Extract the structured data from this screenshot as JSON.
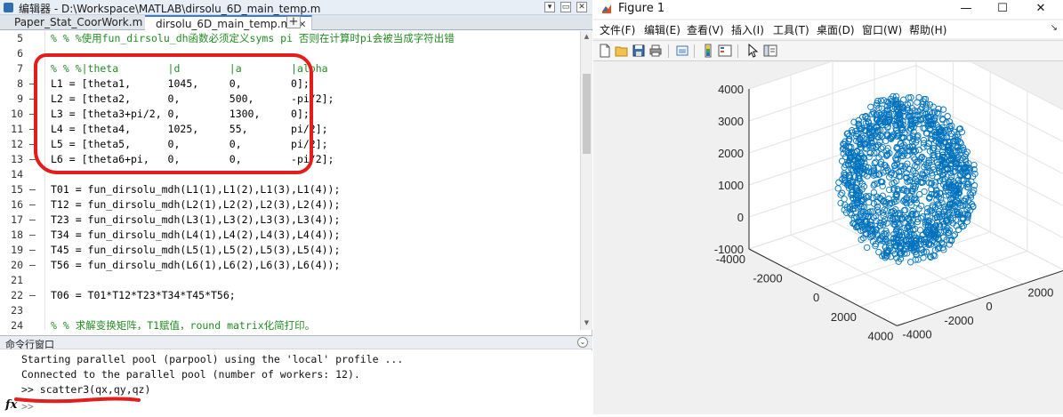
{
  "editor": {
    "title": "编辑器 - D:\\Workspace\\MATLAB\\dirsolu_6D_main_temp.m",
    "controls": {
      "options": "▾",
      "minimize": "▭",
      "close": "✕"
    },
    "tabs": [
      {
        "label": "Paper_Stat_CoorWork.m",
        "close": "✕",
        "active": false
      },
      {
        "label": "dirsolu_6D_main_temp.m",
        "close": "✕",
        "active": true
      }
    ],
    "add_tab": "+",
    "lines": [
      {
        "num": "5",
        "mark": "",
        "text": "% % %使用fun_dirsolu_dh函数必须定义syms pi 否则在计算时pi会被当成字符出错",
        "comment": true
      },
      {
        "num": "6",
        "mark": "",
        "text": "",
        "comment": false
      },
      {
        "num": "7",
        "mark": "",
        "text": "% % %|theta        |d        |a        |alpha",
        "comment": true
      },
      {
        "num": "8",
        "mark": "—",
        "text": "L1 = [theta1,      1045,     0,        0];",
        "comment": false
      },
      {
        "num": "9",
        "mark": "—",
        "text": "L2 = [theta2,      0,        500,      -pi/2];",
        "comment": false
      },
      {
        "num": "10",
        "mark": "—",
        "text": "L3 = [theta3+pi/2, 0,        1300,     0];",
        "comment": false
      },
      {
        "num": "11",
        "mark": "—",
        "text": "L4 = [theta4,      1025,     55,       pi/2];",
        "comment": false
      },
      {
        "num": "12",
        "mark": "—",
        "text": "L5 = [theta5,      0,        0,        pi/2];",
        "comment": false
      },
      {
        "num": "13",
        "mark": "—",
        "text": "L6 = [theta6+pi,   0,        0,        -pi/2];",
        "comment": false
      },
      {
        "num": "14",
        "mark": "",
        "text": "",
        "comment": false
      },
      {
        "num": "15",
        "mark": "—",
        "text": "T01 = fun_dirsolu_mdh(L1(1),L1(2),L1(3),L1(4));",
        "comment": false
      },
      {
        "num": "16",
        "mark": "—",
        "text": "T12 = fun_dirsolu_mdh(L2(1),L2(2),L2(3),L2(4));",
        "comment": false
      },
      {
        "num": "17",
        "mark": "—",
        "text": "T23 = fun_dirsolu_mdh(L3(1),L3(2),L3(3),L3(4));",
        "comment": false
      },
      {
        "num": "18",
        "mark": "—",
        "text": "T34 = fun_dirsolu_mdh(L4(1),L4(2),L4(3),L4(4));",
        "comment": false
      },
      {
        "num": "19",
        "mark": "—",
        "text": "T45 = fun_dirsolu_mdh(L5(1),L5(2),L5(3),L5(4));",
        "comment": false
      },
      {
        "num": "20",
        "mark": "—",
        "text": "T56 = fun_dirsolu_mdh(L6(1),L6(2),L6(3),L6(4));",
        "comment": false
      },
      {
        "num": "21",
        "mark": "",
        "text": "",
        "comment": false
      },
      {
        "num": "22",
        "mark": "—",
        "text": "T06 = T01*T12*T23*T34*T45*T56;",
        "comment": false
      },
      {
        "num": "23",
        "mark": "",
        "text": "",
        "comment": false
      },
      {
        "num": "24",
        "mark": "",
        "text": "% % 求解变换矩阵，T1赋值，round_matrix化简打印。",
        "comment": true
      }
    ]
  },
  "command_window": {
    "header": "命令行窗口",
    "options_icon": "⌄",
    "lines": [
      "Starting parallel pool (parpool) using the 'local' profile ...",
      "Connected to the parallel pool (number of workers: 12).",
      ">> scatter3(qx,qy,qz)"
    ],
    "fx": "fx",
    "prompt": ">>"
  },
  "figure": {
    "title": "Figure 1",
    "controls": {
      "minimize": "—",
      "maximize": "☐",
      "close": "✕"
    },
    "menu": [
      "文件(F)",
      "编辑(E)",
      "查看(V)",
      "插入(I)",
      "工具(T)",
      "桌面(D)",
      "窗口(W)",
      "帮助(H)"
    ],
    "menu_pin": "↘",
    "toolbar_icons": [
      "new-figure-icon",
      "open-file-icon",
      "save-icon",
      "print-icon",
      "link-plot-icon",
      "colorbar-icon",
      "legend-icon",
      "pointer-icon",
      "property-inspector-icon"
    ],
    "accent_color": "#0072bd"
  },
  "chart_data": {
    "type": "scatter",
    "series": [
      {
        "kind": "scatter3",
        "marker": "o",
        "color": "#0072bd",
        "shape": "dense sphere of points",
        "center": [
          0,
          0,
          1500
        ],
        "radius": 2500
      }
    ],
    "xlim": [
      -4000,
      4000
    ],
    "ylim": [
      -4000,
      4000
    ],
    "zlim": [
      -1000,
      4000
    ],
    "x_ticks": [
      "-4000",
      "-2000",
      "0",
      "2000",
      "4000"
    ],
    "y_ticks": [
      "-4000",
      "-2000",
      "0",
      "2000",
      "4000"
    ],
    "z_ticks": [
      "-1000",
      "0",
      "1000",
      "2000",
      "3000",
      "4000"
    ],
    "grid": true
  }
}
